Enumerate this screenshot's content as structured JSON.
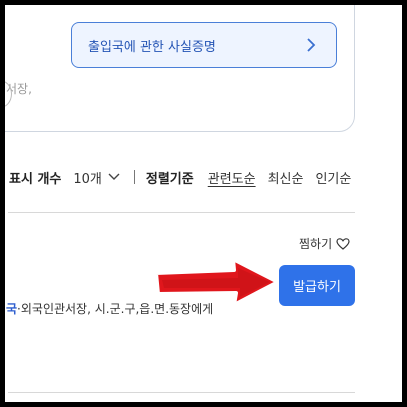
{
  "top": {
    "cert_button_label": "출입국에 관한 사실증명",
    "cut_text": "서장,"
  },
  "sort_bar": {
    "count_label": "표시 개수",
    "count_value": "10개",
    "sort_label": "정렬기준",
    "options": [
      "관련도순",
      "최신순",
      "인기순"
    ]
  },
  "item": {
    "favorite_label": "찜하기",
    "issue_label": "발급하기",
    "desc_highlight": "국",
    "desc_rest": "·외국인관서장, 시.군.구,읍.면.동장에게"
  },
  "colors": {
    "accent": "#2f72e9",
    "arrow": "#e0161c"
  }
}
